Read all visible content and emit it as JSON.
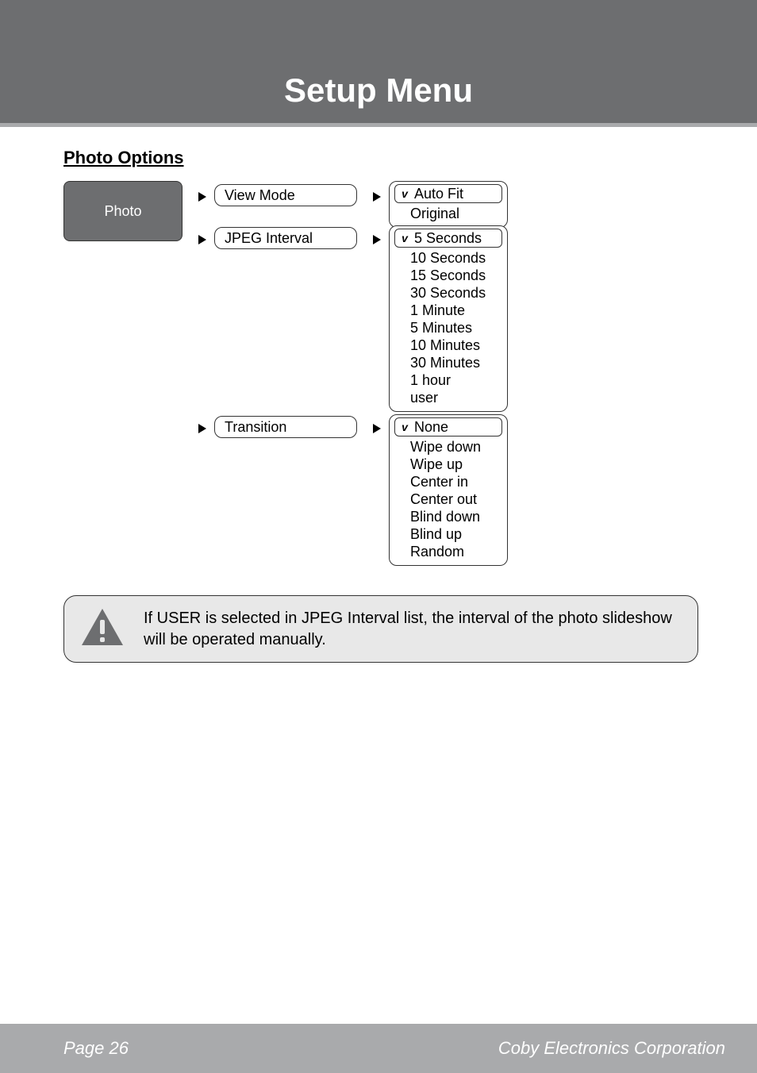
{
  "header": {
    "title": "Setup Menu"
  },
  "section": {
    "title": "Photo Options"
  },
  "root": {
    "label": "Photo"
  },
  "menus": {
    "view_mode": {
      "label": "View Mode",
      "options": [
        {
          "label": "Auto Fit",
          "checked": true
        },
        {
          "label": "Original",
          "checked": false
        }
      ]
    },
    "jpeg_interval": {
      "label": "JPEG Interval",
      "options": [
        {
          "label": "5 Seconds",
          "checked": true
        },
        {
          "label": "10 Seconds",
          "checked": false
        },
        {
          "label": "15 Seconds",
          "checked": false
        },
        {
          "label": "30 Seconds",
          "checked": false
        },
        {
          "label": "1 Minute",
          "checked": false
        },
        {
          "label": "5 Minutes",
          "checked": false
        },
        {
          "label": "10 Minutes",
          "checked": false
        },
        {
          "label": "30 Minutes",
          "checked": false
        },
        {
          "label": "1 hour",
          "checked": false
        },
        {
          "label": "user",
          "checked": false
        }
      ]
    },
    "transition": {
      "label": "Transition",
      "options": [
        {
          "label": "None",
          "checked": true
        },
        {
          "label": "Wipe down",
          "checked": false
        },
        {
          "label": "Wipe up",
          "checked": false
        },
        {
          "label": "Center in",
          "checked": false
        },
        {
          "label": "Center out",
          "checked": false
        },
        {
          "label": "Blind down",
          "checked": false
        },
        {
          "label": "Blind up",
          "checked": false
        },
        {
          "label": "Random",
          "checked": false
        }
      ]
    }
  },
  "note": {
    "text": "If USER is selected in JPEG Interval list, the interval of the photo slideshow will be operated manually."
  },
  "footer": {
    "page": "Page 26",
    "company": "Coby Electronics Corporation"
  }
}
